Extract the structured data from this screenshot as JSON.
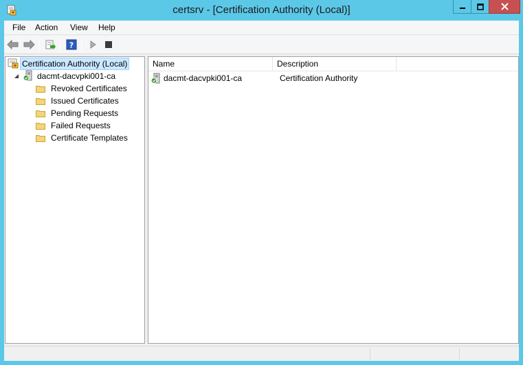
{
  "window": {
    "title": "certsrv - [Certification Authority (Local)]",
    "app_icon": "certsrv-icon"
  },
  "menubar": {
    "items": [
      {
        "label": "File"
      },
      {
        "label": "Action"
      },
      {
        "label": "View"
      },
      {
        "label": "Help"
      }
    ]
  },
  "toolbar": {
    "buttons": [
      "back-arrow-icon",
      "forward-arrow-icon",
      "export-list-icon",
      "help-icon",
      "start-service-icon",
      "stop-service-icon"
    ]
  },
  "tree": {
    "root": {
      "label": "Certification Authority (Local)",
      "selected": true
    },
    "ca_node": {
      "label": "dacmt-dacvpki001-ca",
      "expanded": true
    },
    "children": [
      {
        "label": "Revoked Certificates"
      },
      {
        "label": "Issued Certificates"
      },
      {
        "label": "Pending Requests"
      },
      {
        "label": "Failed Requests"
      },
      {
        "label": "Certificate Templates"
      }
    ]
  },
  "list": {
    "columns": [
      {
        "label": "Name"
      },
      {
        "label": "Description"
      }
    ],
    "rows": [
      {
        "name": "dacmt-dacvpki001-ca",
        "description": "Certification Authority"
      }
    ]
  },
  "colors": {
    "title_bar": "#5bc8e8",
    "close_button": "#c75050",
    "selection": "#cce8ff",
    "folder": "#f0c850"
  }
}
